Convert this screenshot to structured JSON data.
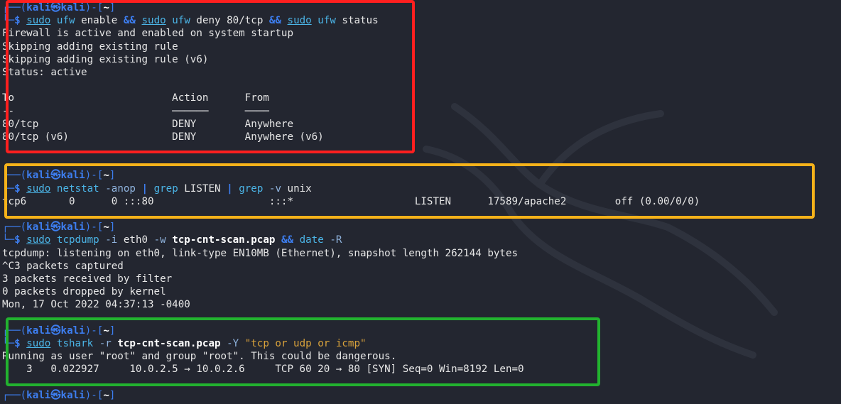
{
  "prompt": {
    "user": "kali",
    "at": "㉿",
    "host": "kali",
    "dir": "~",
    "top_prefix": "┌──(",
    "mid": ")-[",
    "end": "]",
    "bottom_prefix": "└─",
    "dollar": "$ "
  },
  "cmd1": {
    "sudo1": "sudo",
    "ufw1": "ufw",
    "enable": " enable ",
    "and1": "&&",
    "sudo2": "sudo",
    "ufw2": "ufw",
    "deny": " deny 80/tcp ",
    "and2": "&&",
    "sudo3": "sudo",
    "ufw3": "ufw",
    "status": " status"
  },
  "out1": [
    "Firewall is active and enabled on system startup",
    "Skipping adding existing rule",
    "Skipping adding existing rule (v6)",
    "Status: active",
    "",
    "To                          Action      From",
    "--                          ──────      ────",
    "80/tcp                      DENY        Anywhere",
    "80/tcp (v6)                 DENY        Anywhere (v6)"
  ],
  "cmd2": {
    "sudo": "sudo",
    "netstat": "netstat",
    "opts": " -anop ",
    "pipe1": "|",
    "grep1": "grep",
    "listen": " LISTEN ",
    "pipe2": "|",
    "grep2": "grep",
    "v": " -v",
    "unix": " unix"
  },
  "out2": "tcp6       0      0 :::80                   :::*                    LISTEN      17589/apache2        off (0.00/0/0)",
  "cmd3": {
    "sudo": "sudo",
    "tcpdump": "tcpdump",
    "i": " -i",
    "eth0": " eth0",
    "w": " -w ",
    "file": "tcp-cnt-scan.pcap",
    "and": " &&",
    "date": " date",
    "R": " -R"
  },
  "out3": [
    "tcpdump: listening on eth0, link-type EN10MB (Ethernet), snapshot length 262144 bytes",
    "^C3 packets captured",
    "3 packets received by filter",
    "0 packets dropped by kernel",
    "Mon, 17 Oct 2022 04:37:13 -0400"
  ],
  "cmd4": {
    "sudo": "sudo",
    "tshark": "tshark",
    "r": " -r ",
    "file": "tcp-cnt-scan.pcap",
    "Y": " -Y ",
    "filter": "\"tcp or udp or icmp\""
  },
  "out4": [
    "Running as user \"root\" and group \"root\". This could be dangerous.",
    "    3   0.022927     10.0.2.5 → 10.0.2.6     TCP 60 20 → 80 [SYN] Seq=0 Win=8192 Len=0"
  ],
  "colors": {
    "bg": "#232630",
    "prompt": "#3d7ef0",
    "red": "#ff1f1f",
    "yellow": "#f6b21a",
    "green": "#22b22f"
  }
}
